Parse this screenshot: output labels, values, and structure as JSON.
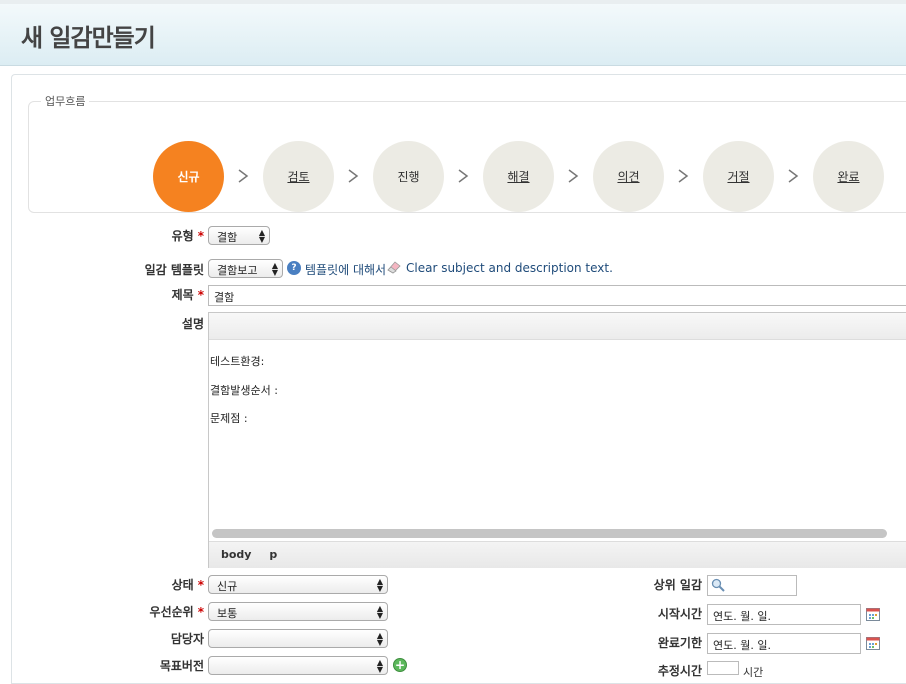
{
  "page": {
    "title": "새 일감만들기"
  },
  "workflow": {
    "legend": "업무흐름",
    "steps": [
      {
        "label": "신규",
        "active": true
      },
      {
        "label": "검토",
        "active": false
      },
      {
        "label": "진행",
        "active": false
      },
      {
        "label": "해결",
        "active": false
      },
      {
        "label": "의견",
        "active": false
      },
      {
        "label": "거절",
        "active": false
      },
      {
        "label": "완료",
        "active": false
      }
    ]
  },
  "form": {
    "required_mark": "*",
    "type": {
      "label": "유형",
      "value": "결함"
    },
    "template": {
      "label": "일감 템플릿",
      "value": "결함보고",
      "about_link": "템플릿에 대해서",
      "clear_link": "Clear subject and description text."
    },
    "subject": {
      "label": "제목",
      "value": "결함"
    },
    "description": {
      "label": "설명",
      "lines": [
        "테스트환경:",
        "결함발생순서 :",
        "문제점 :"
      ],
      "path": [
        "body",
        "p"
      ]
    },
    "status": {
      "label": "상태",
      "value": "신규"
    },
    "priority": {
      "label": "우선순위",
      "value": "보통"
    },
    "assignee": {
      "label": "담당자",
      "value": ""
    },
    "target_version": {
      "label": "목표버전",
      "value": ""
    },
    "parent_issue": {
      "label": "상위 일감",
      "value": ""
    },
    "start_date": {
      "label": "시작시간",
      "placeholder": "연도. 월. 일."
    },
    "due_date": {
      "label": "완료기한",
      "placeholder": "연도. 월. 일."
    },
    "estimated": {
      "label": "추정시간",
      "value": "",
      "unit": "시간"
    }
  },
  "colors": {
    "accent": "#f58220",
    "step_inactive": "#ecebe4",
    "link": "#1f4b7a",
    "required": "#cc0000"
  },
  "icons": {
    "chevron": "chevron-right-icon",
    "help": "help-icon",
    "eraser": "eraser-icon",
    "search": "search-icon",
    "calendar": "calendar-icon",
    "add": "add-icon"
  }
}
